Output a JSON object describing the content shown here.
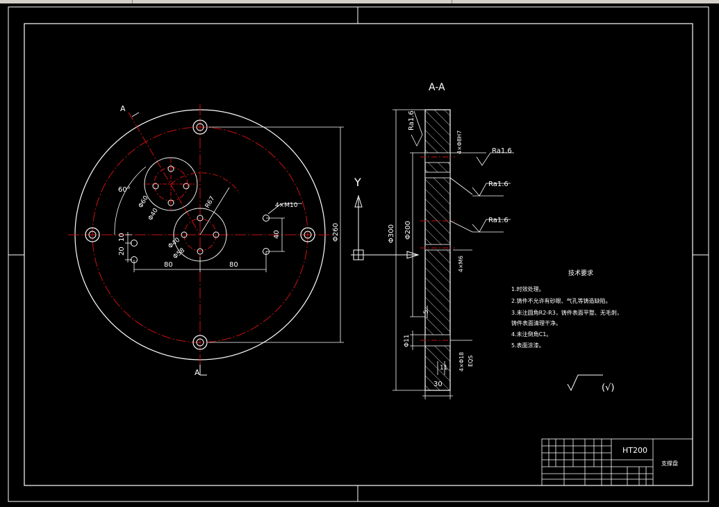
{
  "section_label": "A-A",
  "cut_top": "A",
  "cut_bottom": "A",
  "axis_label": "Y",
  "front_view": {
    "angle": "60°",
    "dims": {
      "d60": "Φ60",
      "d40_top": "Φ40",
      "r67": "R67",
      "d40_center": "Φ40",
      "d58": "Φ58",
      "m10": "4×M10",
      "v40": "40",
      "v20": "20",
      "v10": "10",
      "h80_left": "80",
      "h80_right": "80",
      "d260": "Φ260"
    }
  },
  "section_view": {
    "d300": "Φ300",
    "d200": "Φ200",
    "ra_top_left": "Ra1.6",
    "ra1": "Ra1.6",
    "ra2": "Ra1.6",
    "ra3": "Ra1.6",
    "hole_top": "4×Φ8H7",
    "m6": "4×M6",
    "d11": "Φ11",
    "d18": "4×Φ18",
    "d18_sub": "EQS",
    "dim_11": "11",
    "dim_30": "30",
    "dim_5": "5"
  },
  "tech_req": {
    "title": "技术要求",
    "items": [
      "1.时效处理。",
      "2.铸件不允许有砂眼、气孔等铸造缺陷。",
      "3.未注圆角R2-R3，铸件表面平整、无毛刺，",
      "铸件表面清理干净。",
      "4.未注倒角C1。",
      "5.表面涂漆。"
    ]
  },
  "roughness_general": "(√)",
  "title_block": {
    "material": "HT200",
    "part_name": "支撑盘"
  }
}
